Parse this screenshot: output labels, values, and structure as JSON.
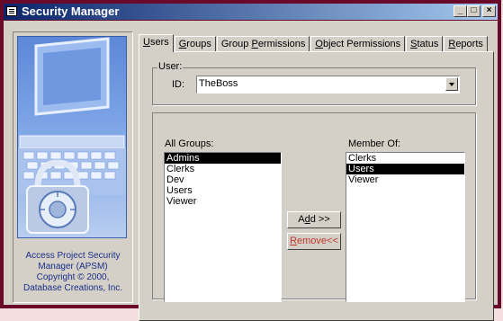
{
  "window": {
    "title": "Security Manager",
    "buttons": {
      "minimize": "_",
      "maximize": "□",
      "close": "×"
    }
  },
  "sidebar": {
    "caption_lines": [
      "Access Project Security",
      "Manager (APSM)",
      "Copyright © 2000,",
      "Database Creations, Inc."
    ]
  },
  "tabs": [
    {
      "accel": "U",
      "rest": "sers",
      "active": true
    },
    {
      "accel": "G",
      "rest": "roups",
      "active": false
    },
    {
      "pre": "Group ",
      "accel": "P",
      "rest": "ermissions",
      "active": false
    },
    {
      "accel": "O",
      "rest": "bject Permissions",
      "active": false
    },
    {
      "accel": "S",
      "rest": "tatus",
      "active": false
    },
    {
      "accel": "R",
      "rest": "eports",
      "active": false
    }
  ],
  "user_section": {
    "group_label": "User:",
    "id_label": "ID:",
    "id_value": "TheBoss"
  },
  "groups_section": {
    "all_groups_label": "All Groups:",
    "member_of_label": "Member Of:",
    "all_groups": [
      "Admins",
      "Clerks",
      "Dev",
      "Users",
      "Viewer"
    ],
    "all_groups_selected": "Admins",
    "member_of": [
      "Clerks",
      "Users",
      "Viewer"
    ],
    "member_of_selected": "Users",
    "add_label_accel": "d",
    "add_label_pre": "A",
    "add_label_rest": "d >>",
    "remove_label_accel": "R",
    "remove_label_rest": "emove<<"
  },
  "colors": {
    "title_gradient_start": "#0a246a",
    "title_gradient_end": "#a6caf0",
    "frame": "#6a0a2a",
    "caption_text": "#1a2e8a",
    "remove_text": "#c0392b",
    "art_blue": "#5d88d8"
  },
  "icons": [
    "app-system-icon",
    "minimize-icon",
    "maximize-icon",
    "close-icon",
    "combo-dropdown-icon",
    "laptop-lock-illustration"
  ]
}
